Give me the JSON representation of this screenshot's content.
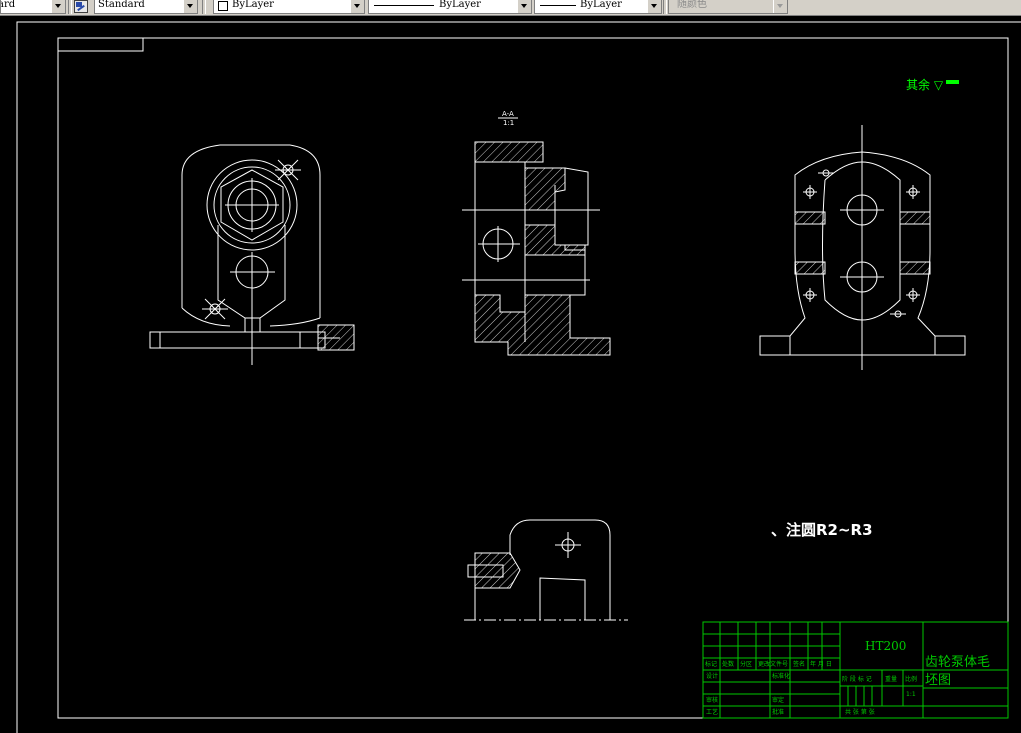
{
  "toolbar": {
    "text_style": "ard",
    "dim_style": "Standard",
    "layer": "ByLayer",
    "linetype": "ByLayer",
    "lineweight": "ByLayer",
    "plot_style": "随颜色"
  },
  "drawing": {
    "section_label_top": "A-A",
    "section_label_bottom": "1:1",
    "roughness_note": "其余 ▽",
    "note": "、注圆R2~R3",
    "title_block": {
      "material": "HT200",
      "part_name_line1": "齿轮泵体毛",
      "part_name_line2": "坯图",
      "header_labels": [
        "标记",
        "处数",
        "分区",
        "更改文件号",
        "签名",
        "年 月 日"
      ],
      "row_labels": [
        "设计",
        "审核",
        "工艺"
      ],
      "mid_labels": [
        "标准化",
        "审定",
        "批准"
      ],
      "stage_labels": [
        "阶 段 标 记",
        "重量",
        "比例"
      ],
      "scale": "1:1",
      "sheets": "共   张 第   张"
    }
  },
  "colors": {
    "paper": "#000000",
    "line": "#ffffff",
    "title_block": "#00c800",
    "toolbar": "#d4d0c8"
  }
}
